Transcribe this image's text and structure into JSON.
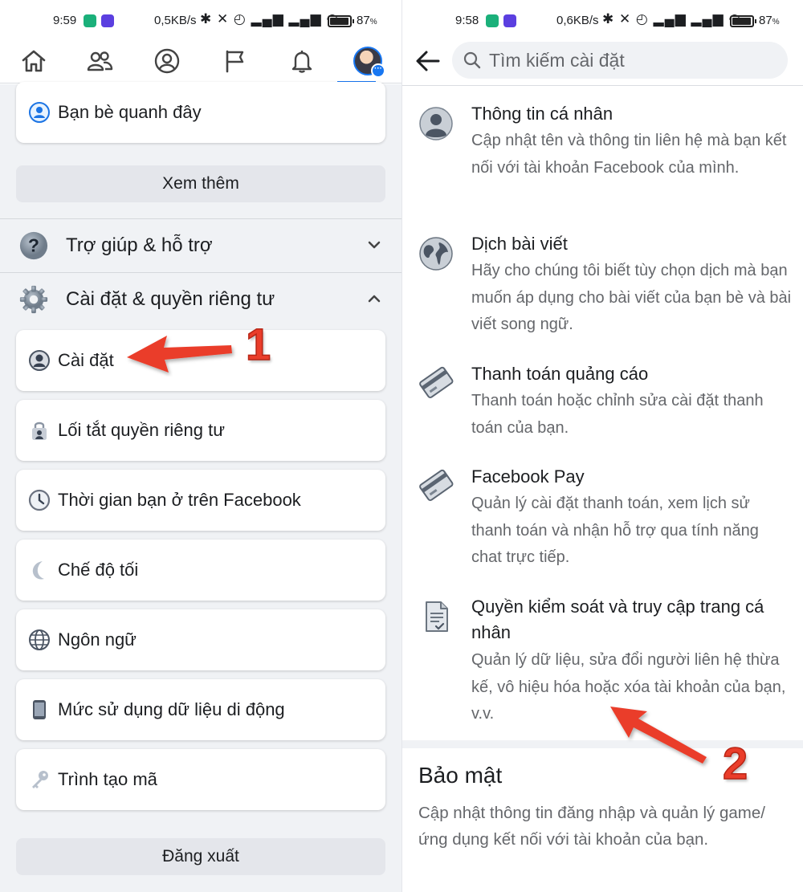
{
  "left_panel": {
    "status_bar": {
      "time": "9:59",
      "network_speed": "0,5KB/s",
      "battery": "87",
      "battery_unit": "%"
    },
    "nav": {
      "icons": [
        "home-icon",
        "friends-icon",
        "profile-icon",
        "flag-icon",
        "bell-icon",
        "avatar-menu"
      ],
      "active_color": "#1877f2"
    },
    "menu": {
      "nearby_friends": "Bạn bè quanh đây",
      "see_more": "Xem thêm",
      "help_support": "Trợ giúp & hỗ trợ",
      "settings_privacy": "Cài đặt & quyền riêng tư",
      "items": [
        {
          "label": "Cài đặt",
          "icon": "user-circle-icon"
        },
        {
          "label": "Lối tắt quyền riêng tư",
          "icon": "lock-user-icon"
        },
        {
          "label": "Thời gian bạn ở trên Facebook",
          "icon": "clock-icon"
        },
        {
          "label": "Chế độ tối",
          "icon": "moon-icon"
        },
        {
          "label": "Ngôn ngữ",
          "icon": "globe-icon"
        },
        {
          "label": "Mức sử dụng dữ liệu di động",
          "icon": "phone-icon"
        },
        {
          "label": "Trình tạo mã",
          "icon": "key-icon"
        }
      ],
      "logout": "Đăng xuất"
    }
  },
  "right_panel": {
    "status_bar": {
      "time": "9:58",
      "network_speed": "0,6KB/s",
      "battery": "87",
      "battery_unit": "%"
    },
    "search": {
      "placeholder": "Tìm kiếm cài đặt"
    },
    "settings": [
      {
        "title": "Thông tin cá nhân",
        "description": "Cập nhật tên và thông tin liên hệ mà bạn kết nối với tài khoản Facebook của mình.",
        "icon": "person-icon"
      },
      {
        "title": "Dịch bài viết",
        "description": "Hãy cho chúng tôi biết tùy chọn dịch mà bạn muốn áp dụng cho bài viết của bạn bè và bài viết song ngữ.",
        "icon": "globe-icon"
      },
      {
        "title": "Thanh toán quảng cáo",
        "description": "Thanh toán hoặc chỉnh sửa cài đặt thanh toán của bạn.",
        "icon": "credit-card-icon"
      },
      {
        "title": "Facebook Pay",
        "description": "Quản lý cài đặt thanh toán, xem lịch sử thanh toán và nhận hỗ trợ qua tính năng chat trực tiếp.",
        "icon": "credit-card-icon"
      },
      {
        "title": "Quyền kiểm soát và truy cập trang cá nhân",
        "description": "Quản lý dữ liệu, sửa đổi người liên hệ thừa kế, vô hiệu hóa hoặc xóa tài khoản của bạn, v.v.",
        "icon": "document-icon"
      }
    ],
    "security_section": {
      "title": "Bảo mật",
      "description": "Cập nhật thông tin đăng nhập và quản lý game/ứng dụng kết nối với tài khoản của bạn."
    }
  },
  "annotations": {
    "step1": "1",
    "step2": "2",
    "arrow_color": "#ea3d2a"
  }
}
